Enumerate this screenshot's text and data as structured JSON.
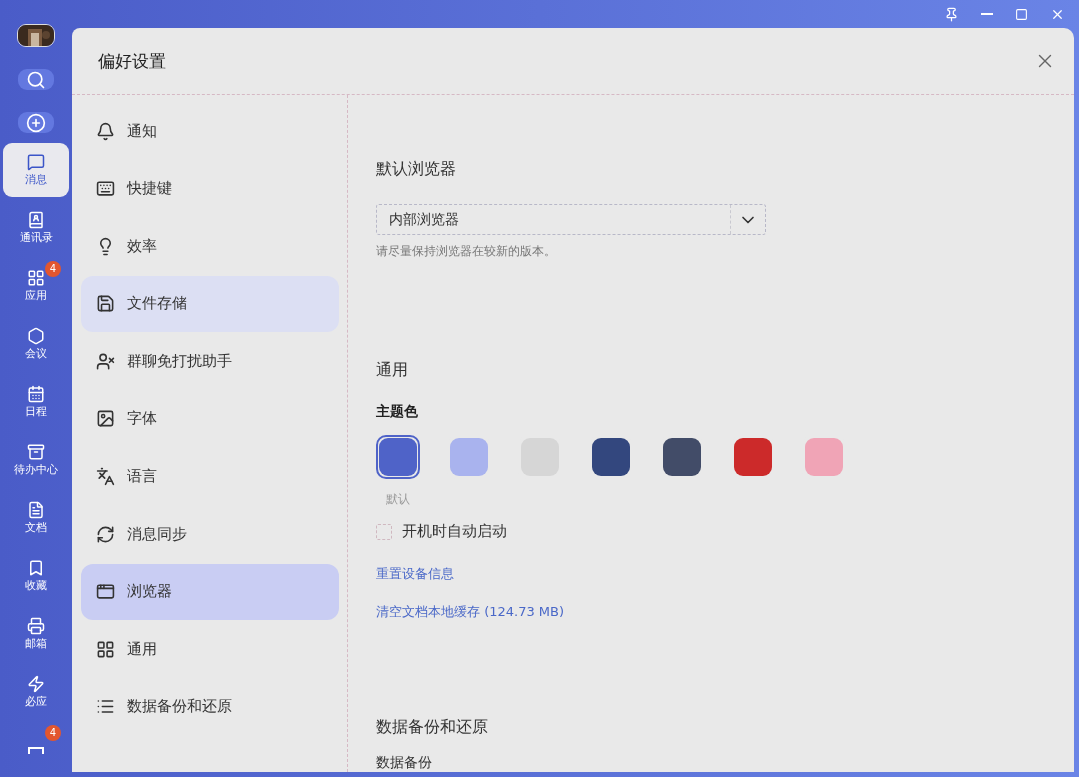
{
  "rail": {
    "items": [
      {
        "label": "消息",
        "selected": true
      },
      {
        "label": "通讯录",
        "selected": false
      },
      {
        "label": "应用",
        "selected": false,
        "badge": "4"
      },
      {
        "label": "会议",
        "selected": false
      },
      {
        "label": "日程",
        "selected": false
      },
      {
        "label": "待办中心",
        "selected": false
      },
      {
        "label": "文档",
        "selected": false
      },
      {
        "label": "收藏",
        "selected": false
      },
      {
        "label": "邮箱",
        "selected": false
      },
      {
        "label": "必应",
        "selected": false
      },
      {
        "selected": false,
        "badge": "4"
      }
    ]
  },
  "dialog": {
    "title": "偏好设置"
  },
  "nav": [
    {
      "label": "通知",
      "selected": false,
      "hovered": false
    },
    {
      "label": "快捷键",
      "selected": false,
      "hovered": false
    },
    {
      "label": "效率",
      "selected": false,
      "hovered": false
    },
    {
      "label": "文件存储",
      "selected": false,
      "hovered": true
    },
    {
      "label": "群聊免打扰助手",
      "selected": false,
      "hovered": false
    },
    {
      "label": "字体",
      "selected": false,
      "hovered": false
    },
    {
      "label": "语言",
      "selected": false,
      "hovered": false
    },
    {
      "label": "消息同步",
      "selected": false,
      "hovered": false
    },
    {
      "label": "浏览器",
      "selected": true,
      "hovered": false
    },
    {
      "label": "通用",
      "selected": false,
      "hovered": false
    },
    {
      "label": "数据备份和还原",
      "selected": false,
      "hovered": false
    }
  ],
  "browser_section": {
    "heading": "默认浏览器",
    "select_value": "内部浏览器",
    "hint": "请尽量保持浏览器在较新的版本。"
  },
  "general_section": {
    "heading": "通用",
    "theme_label": "主题色",
    "themes": [
      {
        "color": "#4f63c8",
        "selected": true,
        "caption": "默认"
      },
      {
        "color": "#a9b3ee",
        "selected": false
      },
      {
        "color": "#d6d6d6",
        "selected": false
      },
      {
        "color": "#33477e",
        "selected": false
      },
      {
        "color": "#424c68",
        "selected": false
      },
      {
        "color": "#cc2a2a",
        "selected": false
      },
      {
        "color": "#f0a4b6",
        "selected": false
      }
    ],
    "autostart": {
      "label": "开机时自动启动",
      "checked": false
    },
    "links": [
      "重置设备信息",
      "清空文档本地缓存 (124.73 MB)"
    ]
  },
  "backup_section": {
    "heading": "数据备份和还原",
    "subheading": "数据备份"
  }
}
